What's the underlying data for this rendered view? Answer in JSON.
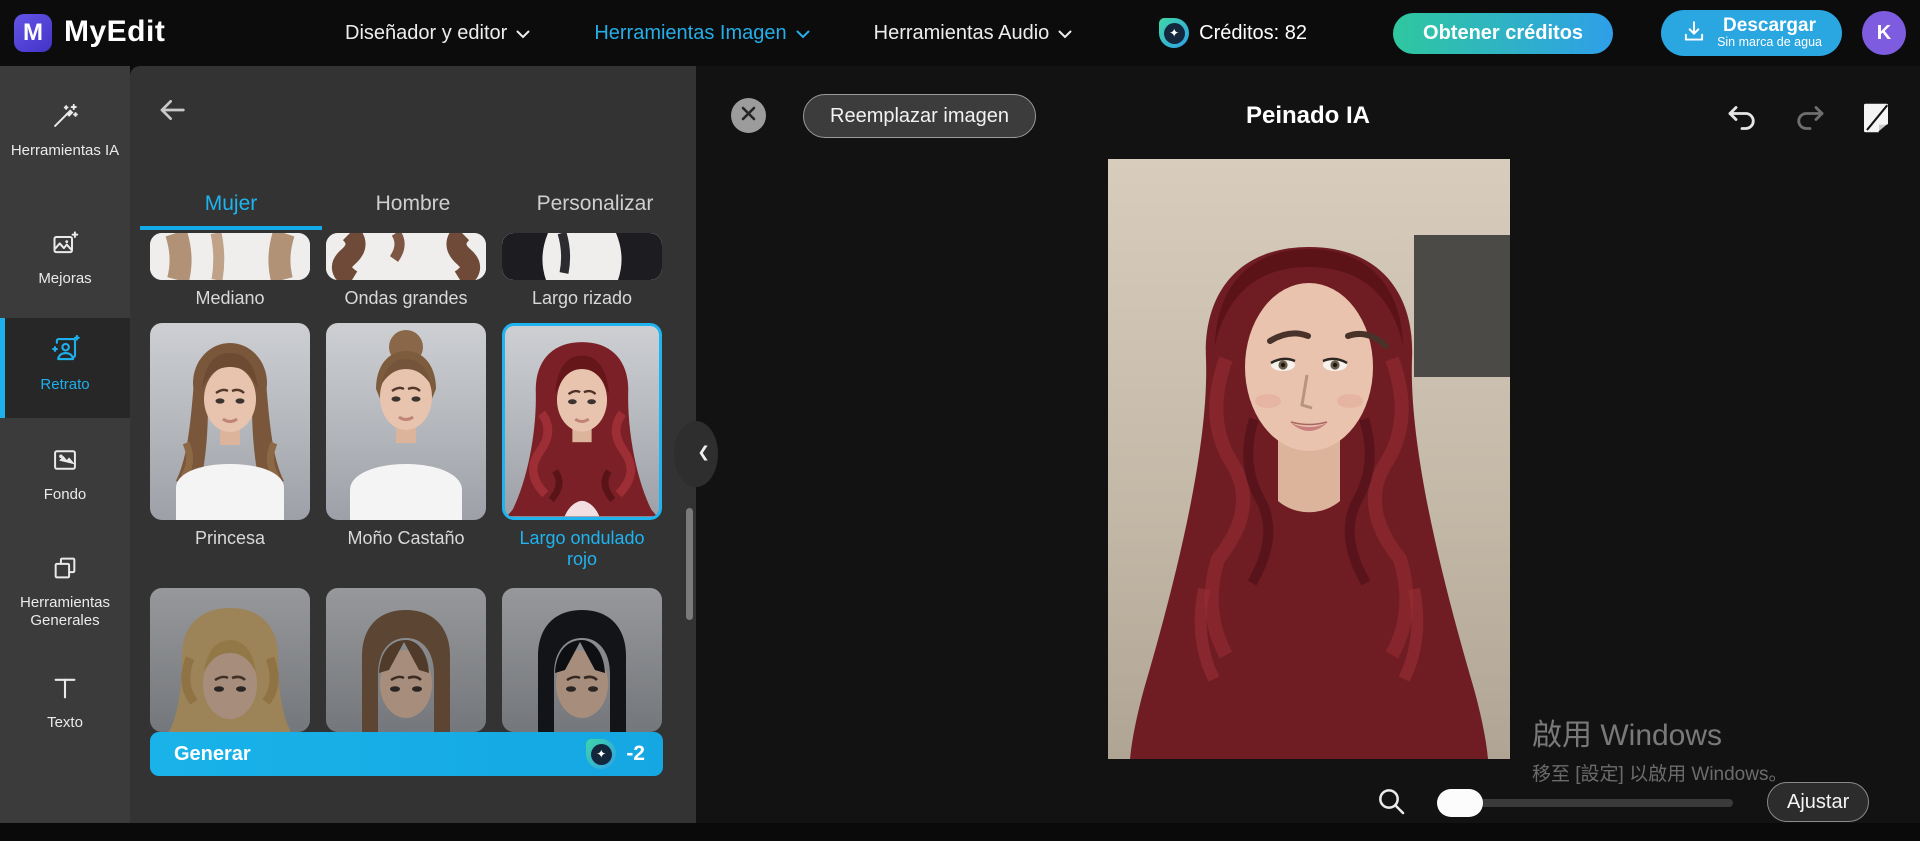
{
  "app": {
    "name": "MyEdit"
  },
  "header": {
    "nav_designer": "Diseñador y editor",
    "nav_image": "Herramientas Imagen",
    "nav_audio": "Herramientas Audio",
    "credits": "Créditos: 82",
    "get_credits": "Obtener créditos",
    "download": "Descargar",
    "download_sub": "Sin marca de agua",
    "avatar_initial": "K"
  },
  "sidebar": {
    "items": [
      {
        "label": "Herramientas IA",
        "icon": "magic-wand-icon",
        "active": false
      },
      {
        "label": "Mejoras",
        "icon": "image-sparkle-icon",
        "active": false
      },
      {
        "label": "Retrato",
        "icon": "portrait-sparkle-icon",
        "active": true
      },
      {
        "label": "Fondo",
        "icon": "background-image-icon",
        "active": false
      },
      {
        "label": "Herramientas Generales",
        "icon": "overlapping-squares-icon",
        "active": false
      },
      {
        "label": "Texto",
        "icon": "text-icon",
        "active": false
      }
    ]
  },
  "panel": {
    "tabs": [
      {
        "label": "Mujer",
        "active": true
      },
      {
        "label": "Hombre",
        "active": false
      },
      {
        "label": "Personalizar",
        "active": false
      }
    ],
    "row_top": [
      {
        "label": "Mediano"
      },
      {
        "label": "Ondas grandes"
      },
      {
        "label": "Largo rizado"
      }
    ],
    "row_mid": [
      {
        "label": "Princesa",
        "selected": false
      },
      {
        "label": "Moño Castaño",
        "selected": false
      },
      {
        "label": "Largo ondulado rojo",
        "selected": true
      }
    ],
    "generate": {
      "label": "Generar",
      "cost": "-2"
    }
  },
  "canvas": {
    "replace_button": "Reemplazar imagen",
    "title": "Peinado IA",
    "watermark_line1": "啟用 Windows",
    "watermark_line2": "移至 [設定] 以啟用 Windows。",
    "fit_button": "Ajustar"
  },
  "icons": {
    "credits": "droplet-sparkle",
    "download": "tray-down-arrow",
    "back": "arrow-left",
    "close": "x-circle",
    "undo": "curved-arrow-left",
    "redo": "curved-arrow-right",
    "compare": "page-fold",
    "zoom": "magnifier",
    "collapse": "chevron-left"
  },
  "colors": {
    "accent": "#1fb0ec",
    "generate_button": "#17ade6",
    "credits_gradient_start": "#3fd6a6",
    "credits_gradient_end": "#2f9fe9",
    "get_credits_gradient_start": "#2fc79f",
    "get_credits_gradient_end": "#2f9fe9",
    "download_button": "#2aa6e0",
    "avatar_bg": "#7e5ce0",
    "logo_bg": "#5547d6",
    "selected_border": "#1fb4f0",
    "sidebar_bg": "#3b3b3b",
    "panel_bg": "#333333",
    "canvas_bg": "#121212"
  }
}
